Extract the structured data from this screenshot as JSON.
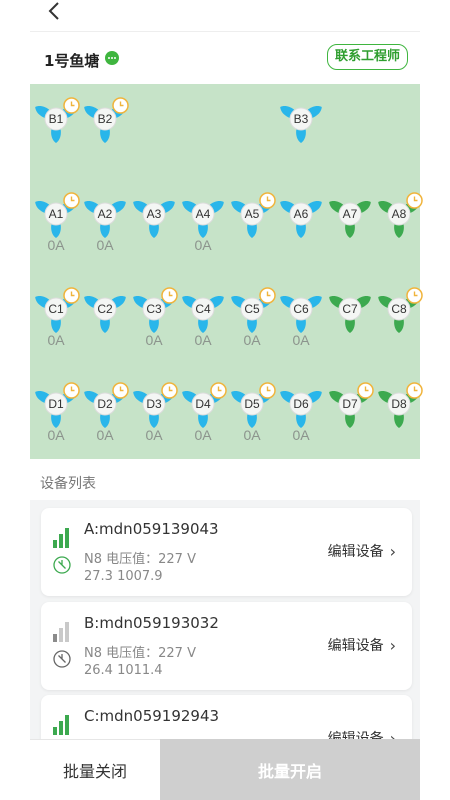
{
  "header": {
    "back_icon": "back-chevron-icon"
  },
  "pond": {
    "name": "1号鱼塘",
    "status_icon": "more-dots-icon",
    "status_color": "#3fb53f",
    "contact_label": "联系工程师"
  },
  "colors": {
    "blue": "#29b6ea",
    "green": "#3ca94f",
    "accent": "#3fb53f",
    "clock": "#f0b43c",
    "map_bg": "#c6e3c8"
  },
  "aerators": [
    {
      "id": "B1",
      "color": "blue",
      "timer": true,
      "amp": ""
    },
    {
      "id": "B2",
      "color": "blue",
      "timer": true,
      "amp": ""
    },
    {
      "id": "B3",
      "color": "blue",
      "timer": false,
      "amp": ""
    },
    {
      "id": "A1",
      "color": "blue",
      "timer": true,
      "amp": "0A"
    },
    {
      "id": "A2",
      "color": "blue",
      "timer": false,
      "amp": "0A"
    },
    {
      "id": "A3",
      "color": "blue",
      "timer": false,
      "amp": ""
    },
    {
      "id": "A4",
      "color": "blue",
      "timer": false,
      "amp": "0A"
    },
    {
      "id": "A5",
      "color": "blue",
      "timer": true,
      "amp": ""
    },
    {
      "id": "A6",
      "color": "blue",
      "timer": false,
      "amp": ""
    },
    {
      "id": "A7",
      "color": "green",
      "timer": false,
      "amp": ""
    },
    {
      "id": "A8",
      "color": "green",
      "timer": true,
      "amp": ""
    },
    {
      "id": "C1",
      "color": "blue",
      "timer": true,
      "amp": "0A"
    },
    {
      "id": "C2",
      "color": "blue",
      "timer": false,
      "amp": ""
    },
    {
      "id": "C3",
      "color": "blue",
      "timer": true,
      "amp": "0A"
    },
    {
      "id": "C4",
      "color": "blue",
      "timer": false,
      "amp": "0A"
    },
    {
      "id": "C5",
      "color": "blue",
      "timer": true,
      "amp": "0A"
    },
    {
      "id": "C6",
      "color": "blue",
      "timer": false,
      "amp": "0A"
    },
    {
      "id": "C7",
      "color": "green",
      "timer": false,
      "amp": ""
    },
    {
      "id": "C8",
      "color": "green",
      "timer": true,
      "amp": ""
    },
    {
      "id": "D1",
      "color": "blue",
      "timer": true,
      "amp": "0A"
    },
    {
      "id": "D2",
      "color": "blue",
      "timer": true,
      "amp": "0A"
    },
    {
      "id": "D3",
      "color": "blue",
      "timer": true,
      "amp": "0A"
    },
    {
      "id": "D4",
      "color": "blue",
      "timer": true,
      "amp": "0A"
    },
    {
      "id": "D5",
      "color": "blue",
      "timer": true,
      "amp": "0A"
    },
    {
      "id": "D6",
      "color": "blue",
      "timer": false,
      "amp": "0A"
    },
    {
      "id": "D7",
      "color": "green",
      "timer": true,
      "amp": ""
    },
    {
      "id": "D8",
      "color": "green",
      "timer": true,
      "amp": ""
    }
  ],
  "device_list": {
    "title": "设备列表",
    "devices": [
      {
        "name": "A:mdn059139043",
        "voltage": "N8 电压值：227 V",
        "values": "27.3 1007.9",
        "edit_label": "编辑设备",
        "online": true,
        "signal_icon": "signal-strength-icon",
        "status_icon": "power-off-icon"
      },
      {
        "name": "B:mdn059193032",
        "voltage": "N8 电压值：227 V",
        "values": "26.4 1011.4",
        "edit_label": "编辑设备",
        "online": false,
        "signal_icon": "signal-strength-icon",
        "status_icon": "power-off-icon"
      },
      {
        "name": "C:mdn059192943",
        "voltage": "",
        "values": "",
        "edit_label": "编辑设备",
        "online": true,
        "signal_icon": "signal-strength-icon",
        "status_icon": "power-off-icon"
      }
    ]
  },
  "footer": {
    "batch_off_label": "批量关闭",
    "batch_on_label": "批量开启"
  }
}
